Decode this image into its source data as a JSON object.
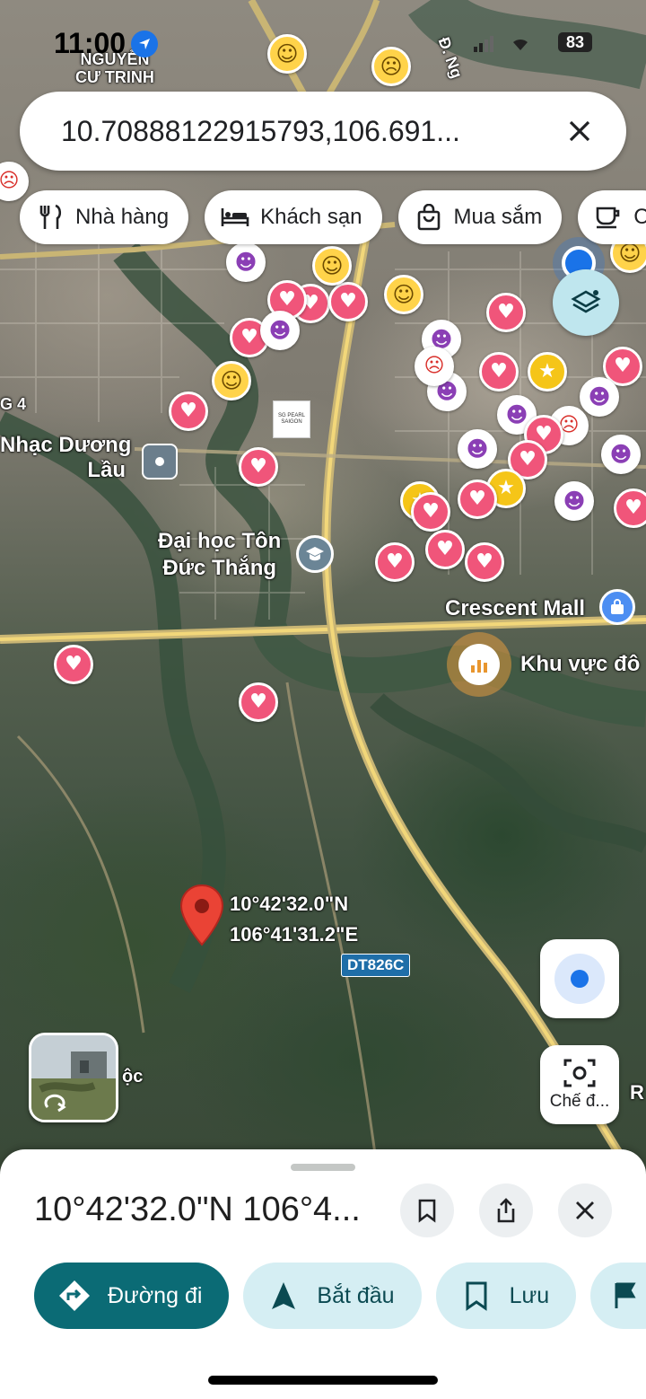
{
  "status_bar": {
    "time": "11:00",
    "battery": "83"
  },
  "search": {
    "value": "10.70888122915793,106.691...",
    "close_icon": "close-icon"
  },
  "chips": [
    {
      "label": "Nhà hàng",
      "icon": "restaurant-icon"
    },
    {
      "label": "Khách sạn",
      "icon": "hotel-icon"
    },
    {
      "label": "Mua sắm",
      "icon": "shopping-icon"
    },
    {
      "label": "C",
      "icon": "coffee-icon"
    }
  ],
  "map": {
    "labels": {
      "nguyen_cu_trinh": "NGUYỄN\nCƯ TRINH",
      "road_top": "Đ. Ng",
      "nhac_duong_lau": "Nhạc Dương\nLầu",
      "ton_duc_thang": "Đại học Tôn\nĐức Thắng",
      "crescent_mall": "Crescent Mall",
      "khu_vuc": "Khu vực đô",
      "district_4": "G 4",
      "pin_lat": "10°42'32.0\"N",
      "pin_lng": "106°41'31.2\"E",
      "road_shield": "DT826C",
      "poc": "ộc",
      "right_r": "R",
      "sg_pearl": "SG PEARL SAIGON"
    },
    "lens_label": "Chế đ..."
  },
  "sheet": {
    "title": "10°42'32.0\"N 106°4...",
    "actions": [
      {
        "label": "Đường đi",
        "icon": "directions-icon",
        "style": "primary"
      },
      {
        "label": "Bắt đầu",
        "icon": "navigation-arrow-icon",
        "style": "secondary"
      },
      {
        "label": "Lưu",
        "icon": "bookmark-icon",
        "style": "secondary"
      }
    ]
  },
  "colors": {
    "primary": "#0b6b75",
    "secondary_bg": "#d5eef3",
    "heart_pin": "#f0557a",
    "pin_red": "#ea4335"
  }
}
